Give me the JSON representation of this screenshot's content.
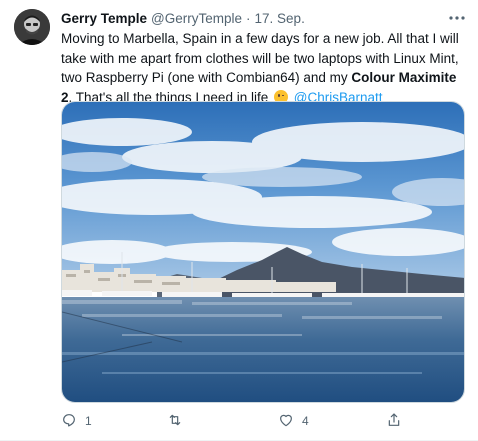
{
  "tweet": {
    "author_name": "Gerry Temple",
    "author_handle": "@GerryTemple",
    "separator": "·",
    "date": "17. Sep.",
    "text_part1": "Moving to Marbella, Spain in a few days for a new job. All that I will take with me apart from clothes will be two laptops with Linux Mint, two Raspberry Pi (one with Combian64) and my ",
    "text_bold": "Colour Maximite 2",
    "text_part2": ". That's all the things I need in life ",
    "emoji": "winking-face",
    "mention": "@ChrisBarnatt",
    "media_description": "Harbour photo: marina with yachts, white buildings and a mountain under a blue sky with clouds"
  },
  "actions": {
    "reply_count": "1",
    "retweet_count": "",
    "like_count": "4",
    "share_count": ""
  },
  "icons": {
    "more": "more-horizontal-icon",
    "reply": "reply-icon",
    "retweet": "retweet-icon",
    "like": "heart-icon",
    "share": "share-icon"
  },
  "colors": {
    "text": "#0f1419",
    "secondary": "#536471",
    "link": "#1d9bf0"
  }
}
